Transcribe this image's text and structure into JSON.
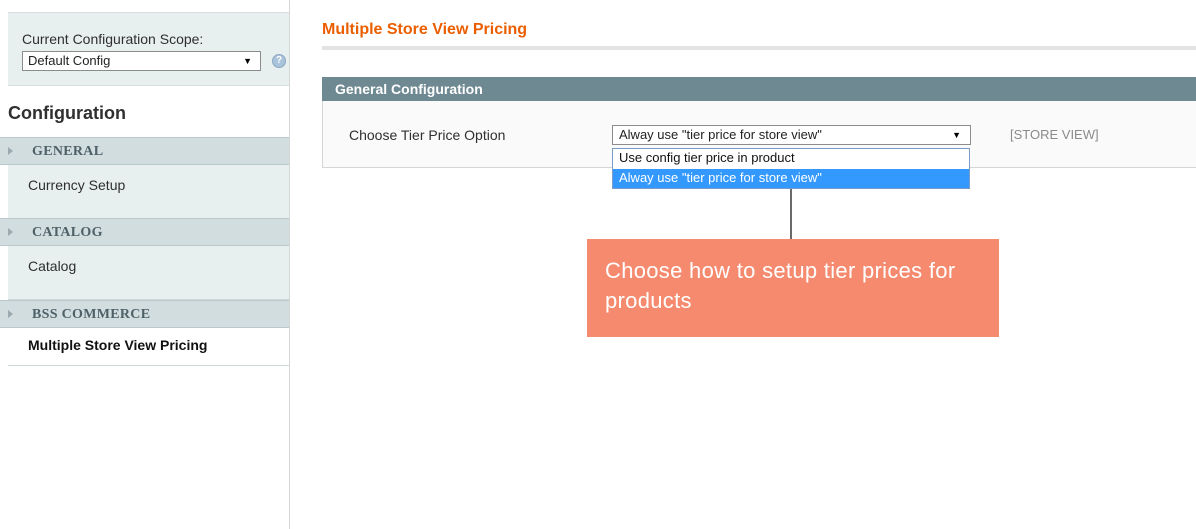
{
  "sidebar": {
    "scope_label": "Current Configuration Scope:",
    "scope_value": "Default Config",
    "help_glyph": "?",
    "heading": "Configuration",
    "groups": [
      {
        "label": "GENERAL",
        "items": [
          "Currency Setup"
        ]
      },
      {
        "label": "CATALOG",
        "items": [
          "Catalog"
        ]
      },
      {
        "label": "BSS COMMERCE",
        "items": [
          "Multiple Store View Pricing"
        ]
      }
    ],
    "active_item": "Multiple Store View Pricing"
  },
  "main": {
    "page_title": "Multiple Store View Pricing",
    "section_title": "General Configuration",
    "field_label": "Choose Tier Price Option",
    "selected_value": "Alway use \"tier price for store view\"",
    "options": [
      "Use config tier price in product",
      "Alway use \"tier price for store view\""
    ],
    "scope_tag": "[STORE VIEW]"
  },
  "callout": {
    "text": "Choose how to setup tier prices for products"
  },
  "icons": {
    "dropdown_arrow": "▼",
    "help": "help-circle-icon",
    "expand": "triangle-right-icon"
  },
  "colors": {
    "title_accent": "#eb5e00",
    "section_header": "#6f8992",
    "group_header": "#d2dde0",
    "selected_option": "#3399ff",
    "callout": "#f58a6f"
  }
}
